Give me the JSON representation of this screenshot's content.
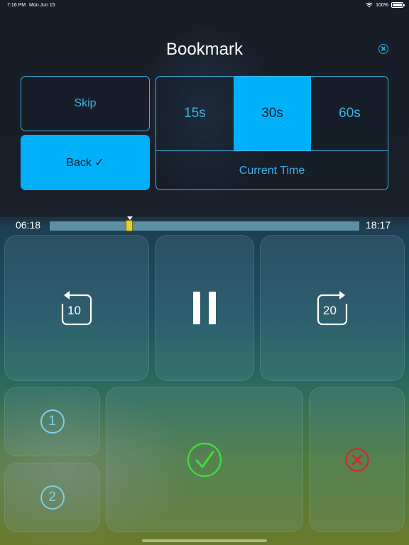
{
  "status_bar": {
    "time": "7:16 PM",
    "date": "Mon Jun 15",
    "battery": "100%",
    "icons": [
      "wifi-icon",
      "battery-icon"
    ]
  },
  "dialog": {
    "title": "Bookmark",
    "close_icon": "close-circle-icon",
    "skip_label": "Skip",
    "back_label": "Back ✓",
    "durations": [
      {
        "label": "15s",
        "selected": false
      },
      {
        "label": "30s",
        "selected": true
      },
      {
        "label": "60s",
        "selected": false
      }
    ],
    "current_time_label": "Current Time"
  },
  "player": {
    "elapsed": "06:18",
    "total": "18:17",
    "progress": 0.25,
    "rewind_seconds": "10",
    "forward_seconds": "20",
    "bookmark_one": "1",
    "bookmark_two": "2",
    "icons": [
      "rewind-icon",
      "pause-icon",
      "forward-icon",
      "confirm-check-icon",
      "cancel-x-icon"
    ]
  },
  "colors": {
    "accent": "#00b0f8",
    "accent_text": "#3fb2e6",
    "confirm": "#3ee03a",
    "cancel": "#e02020",
    "scrubber_thumb": "#e2cf3a"
  }
}
